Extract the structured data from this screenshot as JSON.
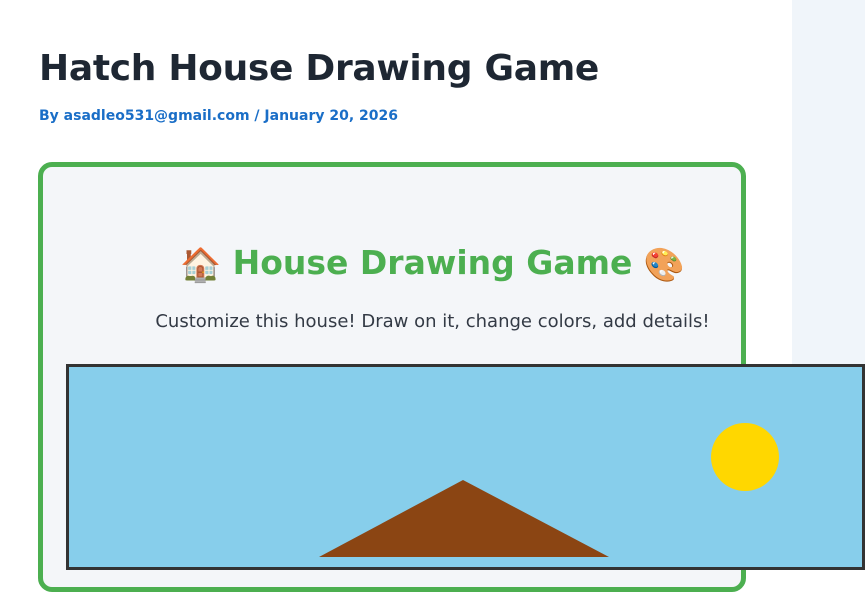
{
  "post": {
    "title": "Hatch House Drawing Game",
    "meta": {
      "by_label": "By",
      "author": "asadleo531@gmail.com",
      "separator": "/",
      "date": "January 20, 2026"
    }
  },
  "game": {
    "heading_emoji_left": "🏠",
    "heading": "House Drawing Game",
    "heading_emoji_right": "🎨",
    "subtitle": "Customize this house! Draw on it, change colors, add details!"
  },
  "canvas": {
    "sky_color": "#87ceeb",
    "sun_color": "#ffd700",
    "roof_color": "#8b4513"
  }
}
